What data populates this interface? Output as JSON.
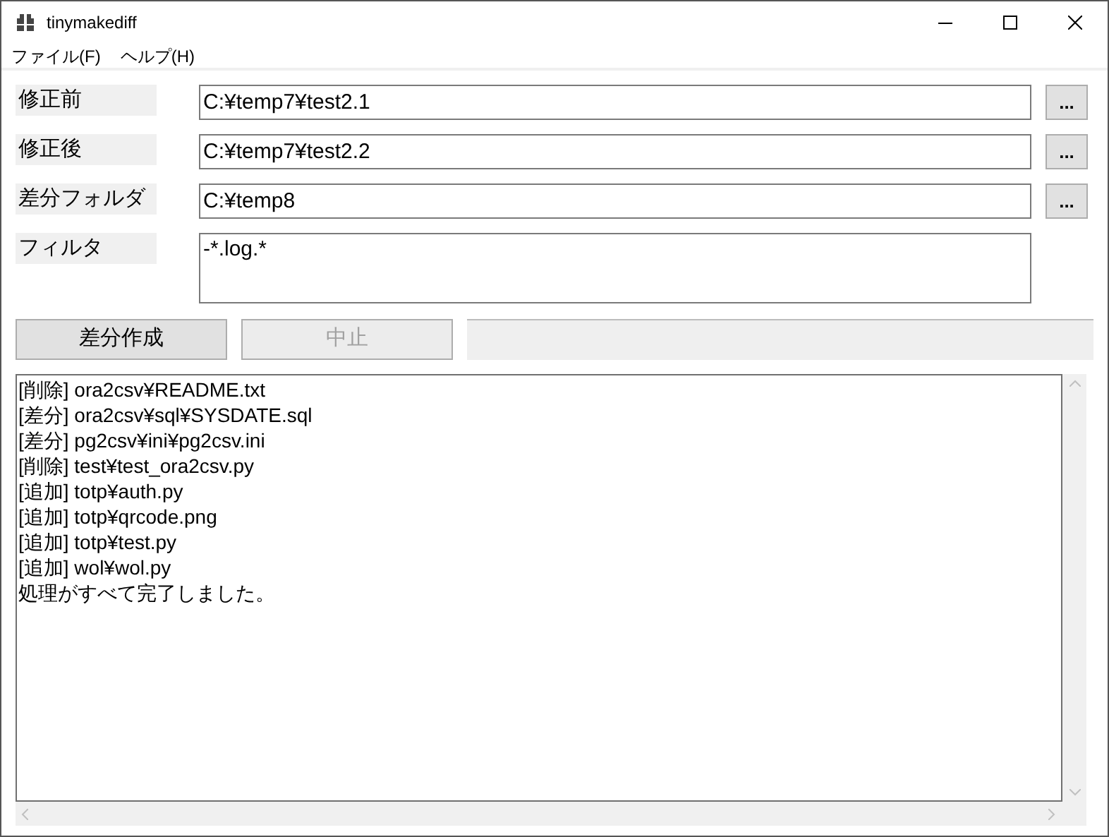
{
  "window": {
    "title": "tinymakediff"
  },
  "menu": [
    {
      "label": "ファイル(F)"
    },
    {
      "label": "ヘルプ(H)"
    }
  ],
  "fields": [
    {
      "label": "修正前",
      "value": "C:¥temp7¥test2.1",
      "browse": "..."
    },
    {
      "label": "修正後",
      "value": "C:¥temp7¥test2.2",
      "browse": "..."
    },
    {
      "label": "差分フォルダ",
      "value": "C:¥temp8",
      "browse": "..."
    }
  ],
  "filter": {
    "label": "フィルタ",
    "value": "-*.log.*"
  },
  "buttons": [
    {
      "label": "差分作成",
      "disabled": false
    },
    {
      "label": "中止",
      "disabled": true
    }
  ],
  "progress": {
    "level": 0
  },
  "log": [
    "[削除] ora2csv¥README.txt",
    "[差分] ora2csv¥sql¥SYSDATE.sql",
    "[差分] pg2csv¥ini¥pg2csv.ini",
    "[削除] test¥test_ora2csv.py",
    "[追加] totp¥auth.py",
    "[追加] totp¥qrcode.png",
    "[追加] totp¥test.py",
    "[追加] wol¥wol.py",
    "処理がすべて完了しました。"
  ]
}
